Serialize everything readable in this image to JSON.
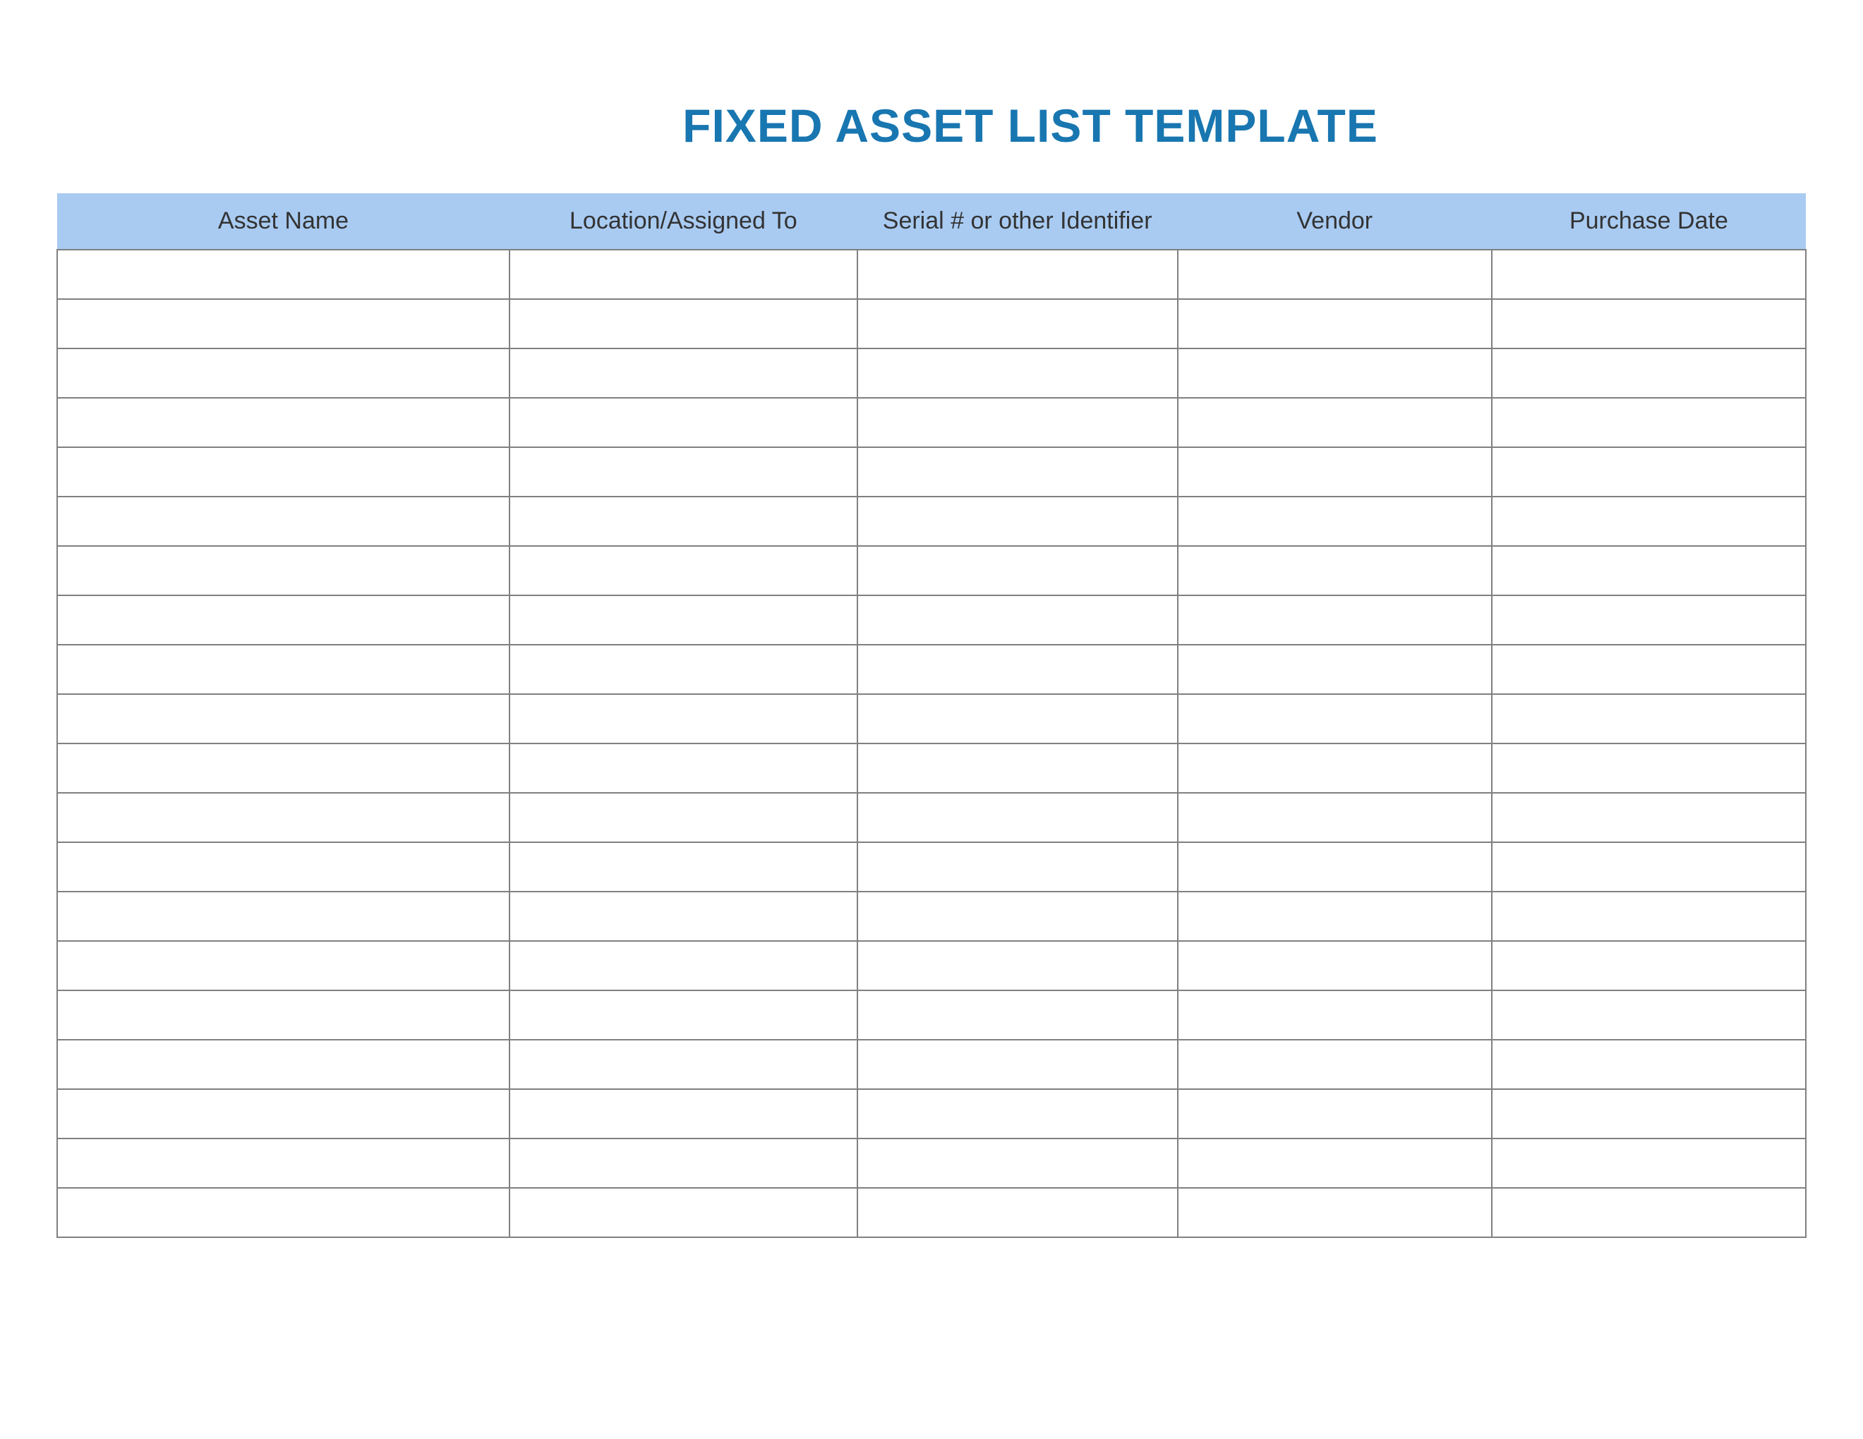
{
  "title": "FIXED ASSET LIST TEMPLATE",
  "columns": [
    "Asset Name",
    "Location/Assigned To",
    "Serial # or other Identifier",
    "Vendor",
    "Purchase Date"
  ],
  "rows": [
    [
      "",
      "",
      "",
      "",
      ""
    ],
    [
      "",
      "",
      "",
      "",
      ""
    ],
    [
      "",
      "",
      "",
      "",
      ""
    ],
    [
      "",
      "",
      "",
      "",
      ""
    ],
    [
      "",
      "",
      "",
      "",
      ""
    ],
    [
      "",
      "",
      "",
      "",
      ""
    ],
    [
      "",
      "",
      "",
      "",
      ""
    ],
    [
      "",
      "",
      "",
      "",
      ""
    ],
    [
      "",
      "",
      "",
      "",
      ""
    ],
    [
      "",
      "",
      "",
      "",
      ""
    ],
    [
      "",
      "",
      "",
      "",
      ""
    ],
    [
      "",
      "",
      "",
      "",
      ""
    ],
    [
      "",
      "",
      "",
      "",
      ""
    ],
    [
      "",
      "",
      "",
      "",
      ""
    ],
    [
      "",
      "",
      "",
      "",
      ""
    ],
    [
      "",
      "",
      "",
      "",
      ""
    ],
    [
      "",
      "",
      "",
      "",
      ""
    ],
    [
      "",
      "",
      "",
      "",
      ""
    ],
    [
      "",
      "",
      "",
      "",
      ""
    ],
    [
      "",
      "",
      "",
      "",
      ""
    ]
  ]
}
